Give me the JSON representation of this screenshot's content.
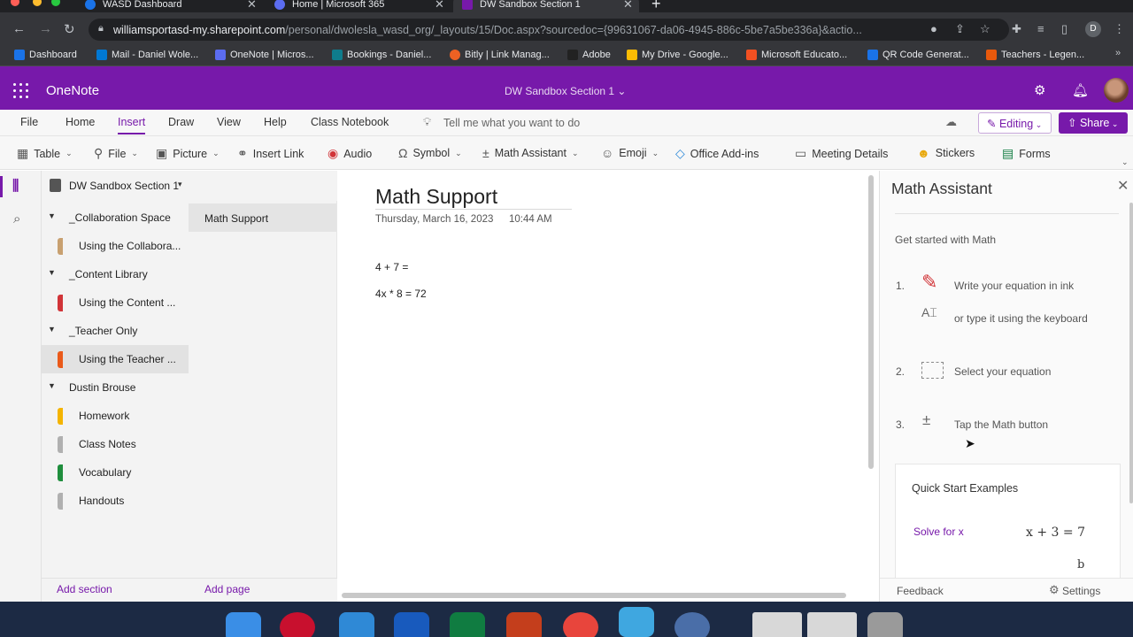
{
  "browser": {
    "tabs": [
      {
        "title": "WASD Dashboard",
        "color": "#1a73e8"
      },
      {
        "title": "Home | Microsoft 365",
        "color": "#5b6cf0"
      },
      {
        "title": "DW Sandbox Section 1",
        "color": "#7719aa"
      }
    ],
    "new_tab": "+",
    "url_host": "williamsportasd-my.sharepoint.com",
    "url_path": "/personal/dwolesla_wasd_org/_layouts/15/Doc.aspx?sourcedoc={99631067-da06-4945-886c-5be7a5be336a}&actio...",
    "bookmarks": [
      {
        "label": "Dashboard",
        "color": "#1a73e8"
      },
      {
        "label": "Mail - Daniel Wole...",
        "color": "#0078d4"
      },
      {
        "label": "OneNote | Micros...",
        "color": "#5b6cf0"
      },
      {
        "label": "Bookings - Daniel...",
        "color": "#0f7c8c"
      },
      {
        "label": "Bitly | Link Manag...",
        "color": "#ee6123"
      },
      {
        "label": "Adobe",
        "color": "#222222"
      },
      {
        "label": "My Drive - Google...",
        "color": "#fbbc04"
      },
      {
        "label": "Microsoft Educato...",
        "color": "#f25022"
      },
      {
        "label": "QR Code Generat...",
        "color": "#1a73e8"
      },
      {
        "label": "Teachers - Legen...",
        "color": "#e8590c"
      }
    ]
  },
  "app": {
    "name": "OneNote",
    "document_title": "DW Sandbox Section 1 ⌄",
    "accent": "#7719aa"
  },
  "ribbon_tabs": [
    "File",
    "Home",
    "Insert",
    "Draw",
    "View",
    "Help",
    "Class Notebook"
  ],
  "ribbon_active": "Insert",
  "tell_me": "Tell me what you want to do",
  "editing_label": "Editing",
  "share_label": "Share",
  "commands": [
    {
      "label": "Table",
      "icon": "table-icon"
    },
    {
      "label": "File",
      "icon": "paperclip-icon"
    },
    {
      "label": "Picture",
      "icon": "picture-icon"
    },
    {
      "label": "Insert Link",
      "icon": "link-icon"
    },
    {
      "label": "Audio",
      "icon": "record-icon"
    },
    {
      "label": "Symbol",
      "icon": "omega-icon"
    },
    {
      "label": "Math Assistant",
      "icon": "math-icon"
    },
    {
      "label": "Emoji",
      "icon": "smiley-icon"
    },
    {
      "label": "Office Add-ins",
      "icon": "addins-icon"
    },
    {
      "label": "Meeting Details",
      "icon": "meeting-icon"
    },
    {
      "label": "Stickers",
      "icon": "sticker-icon"
    },
    {
      "label": "Forms",
      "icon": "forms-icon"
    }
  ],
  "notebook": {
    "name": "DW Sandbox Section 1"
  },
  "sections": {
    "g1": "_Collaboration Space",
    "s1": "Using the Collabora...",
    "g2": "_Content Library",
    "s2": "Using the Content ...",
    "g3": "_Teacher Only",
    "s3": "Using the Teacher ...",
    "g4": "Dustin Brouse",
    "s4": "Homework",
    "s5": "Class Notes",
    "s6": "Vocabulary",
    "s7": "Handouts"
  },
  "pages": [
    "Math Support"
  ],
  "add_section": "Add section",
  "add_page": "Add page",
  "page": {
    "title": "Math Support",
    "date": "Thursday, March 16, 2023",
    "time": "10:44 AM",
    "lines": [
      "4 + 7 =",
      "4x * 8 = 72"
    ]
  },
  "math_assistant": {
    "title": "Math Assistant",
    "intro": "Get started with Math",
    "step1_num": "1.",
    "step1_a": "Write your equation in ink",
    "step1_b": "or type it using the keyboard",
    "step2_num": "2.",
    "step2": "Select your equation",
    "step3_num": "3.",
    "step3": "Tap the Math button",
    "quick_start_title": "Quick Start Examples",
    "example_link": "Solve for x",
    "example_eq": "x + 3 = 7",
    "example_partial": "b",
    "feedback": "Feedback",
    "settings": "Settings"
  }
}
